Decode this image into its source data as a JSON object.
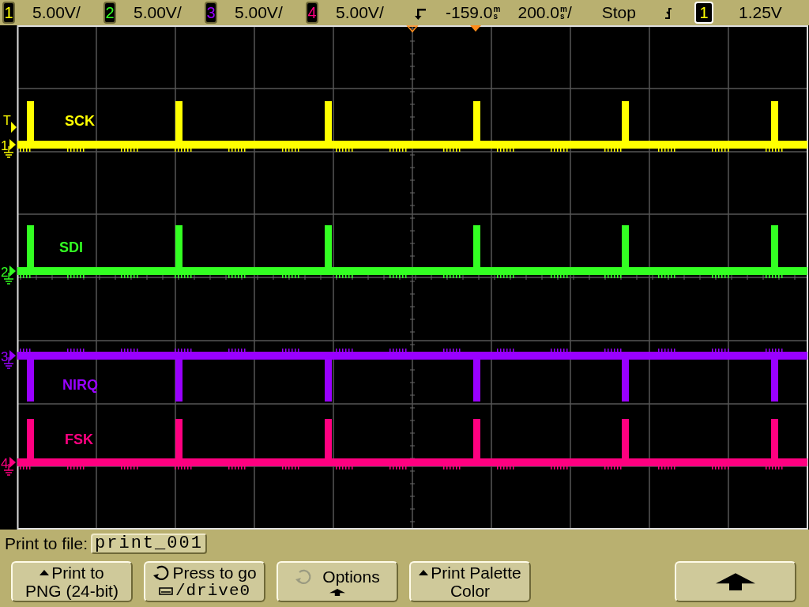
{
  "channels": [
    {
      "number": "1",
      "scale": "5.00V/",
      "color": "#ffff00",
      "marker": "1",
      "label": "SCK",
      "kind": "rising"
    },
    {
      "number": "2",
      "scale": "5.00V/",
      "color": "#33ff22",
      "marker": "2",
      "label": "SDI",
      "kind": "rising"
    },
    {
      "number": "3",
      "scale": "5.00V/",
      "color": "#9900ff",
      "marker": "3",
      "label": "NIRQ",
      "kind": "falling"
    },
    {
      "number": "4",
      "scale": "5.00V/",
      "color": "#ff0080",
      "marker": "4",
      "label": "FSK",
      "kind": "rising"
    }
  ],
  "delay": {
    "value": "-159.0",
    "unit": "ms"
  },
  "timebase": {
    "value": "200.0",
    "unit": "ms",
    "suffix": "/"
  },
  "run_state": "Stop",
  "trigger": {
    "source": "1",
    "threshold": "1.25V",
    "marker": "T"
  },
  "print_to_file": {
    "label": "Print to file:",
    "value": "print_001"
  },
  "softkeys": [
    {
      "kind": "menu",
      "lines": [
        "Print to",
        "PNG (24-bit)"
      ]
    },
    {
      "kind": "entry",
      "lines": [
        "Press to go",
        "/drive0"
      ],
      "knob_enabled": true
    },
    {
      "kind": "submenu",
      "lines": [
        "Options"
      ],
      "knob_enabled": false
    },
    {
      "kind": "menu",
      "lines": [
        "Print Palette",
        "Color"
      ]
    },
    {
      "kind": "empty"
    },
    {
      "kind": "return"
    }
  ]
}
